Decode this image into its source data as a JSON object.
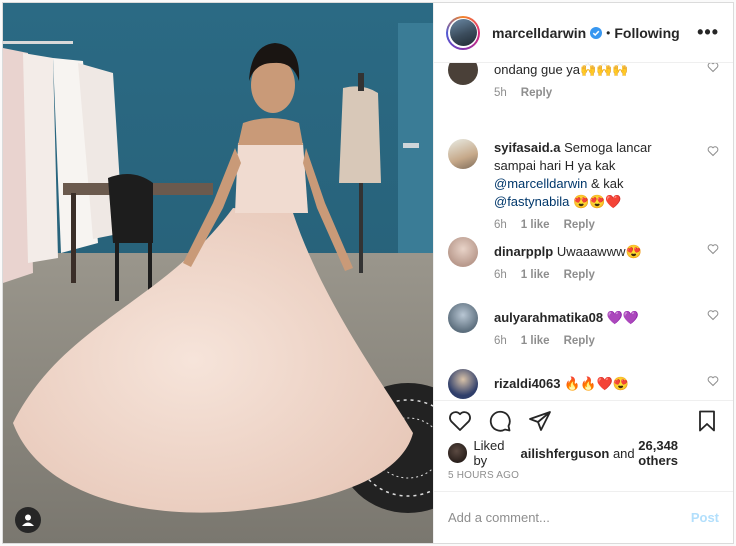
{
  "post": {
    "username": "marcelldarwin",
    "follow_state": "Following",
    "separator": "•",
    "more_label": "•••"
  },
  "comments": [
    {
      "username": "",
      "text": "ondang gue ya🙌🙌🙌",
      "time": "5h",
      "likes": "",
      "reply": "Reply"
    },
    {
      "username": "syifasaid.a",
      "text_before": "Semoga lancar sampai hari H ya kak ",
      "mention1": "@marcelldarwin",
      "middle": " & kak ",
      "mention2": "@fastynabila",
      "text_after": " 😍😍❤️",
      "time": "6h",
      "likes": "1 like",
      "reply": "Reply"
    },
    {
      "username": "dinarpplp",
      "text": "Uwaaawww😍",
      "time": "6h",
      "likes": "1 like",
      "reply": "Reply"
    },
    {
      "username": "aulyarahmatika08",
      "text": "💜💜",
      "time": "6h",
      "likes": "1 like",
      "reply": "Reply"
    },
    {
      "username": "rizaldi4063",
      "text": "🔥🔥❤️😍",
      "time": "",
      "likes": "",
      "reply": ""
    }
  ],
  "likes": {
    "prefix": "Liked by ",
    "user": "ailishferguson",
    "middle": " and ",
    "count": "26,348 others"
  },
  "timestamp": "5 HOURS AGO",
  "add_comment": {
    "placeholder": "Add a comment...",
    "post_label": "Post"
  },
  "colors": {
    "wall": "#2e6d86",
    "floor": "#8a8880",
    "gown": "#f1d9cd",
    "verified": "#3897f0",
    "post_button": "#b2dffc"
  }
}
